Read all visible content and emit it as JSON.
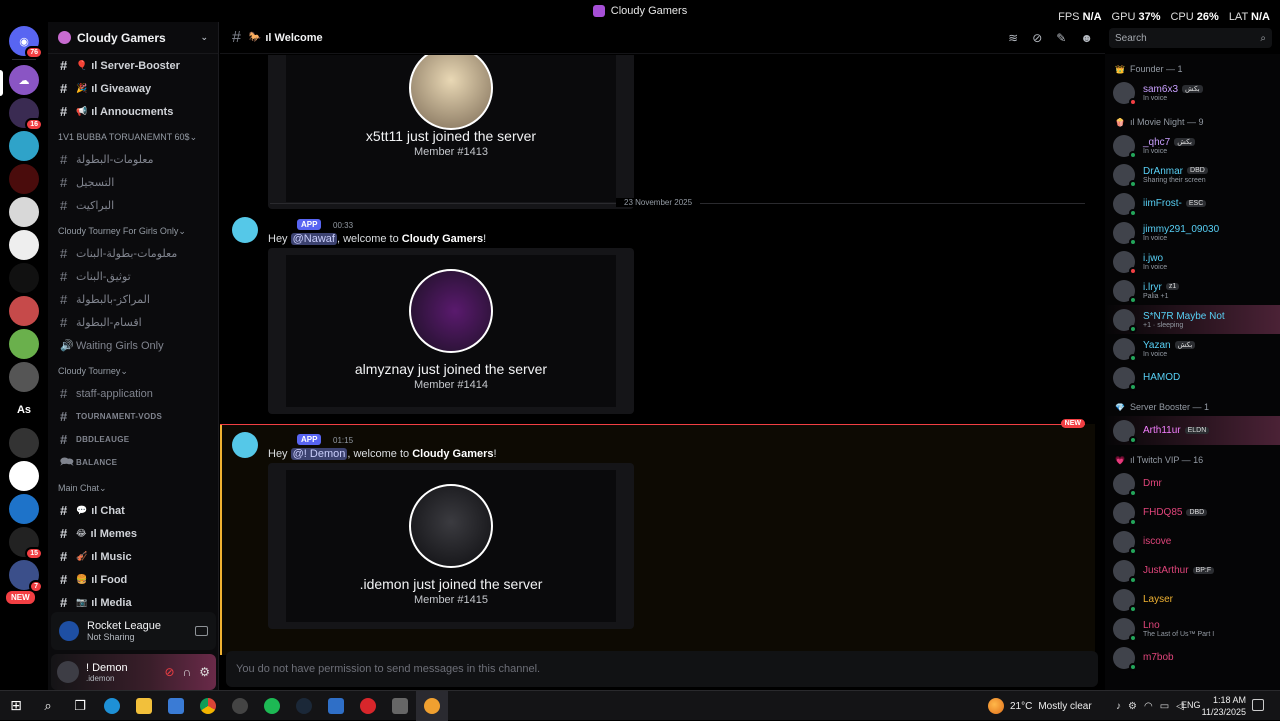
{
  "window": {
    "title": "Cloudy Gamers"
  },
  "overlay": {
    "fps_label": "FPS",
    "fps": "N/A",
    "gpu_label": "GPU",
    "gpu": "37%",
    "cpu_label": "CPU",
    "cpu": "26%",
    "lat_label": "LAT",
    "lat": "N/A"
  },
  "servers": {
    "badges": [
      "76",
      "16",
      "15",
      "7"
    ],
    "new_label": "NEW",
    "as_label": "As"
  },
  "sidebar": {
    "server_name": "Cloudy Gamers",
    "items": [
      {
        "type": "ch",
        "label": "ıl Server-Booster",
        "emo": "🎈",
        "bright": true
      },
      {
        "type": "ch",
        "label": "ıl Giveaway",
        "emo": "🎉",
        "bright": true
      },
      {
        "type": "ch",
        "label": "ıl Annoucments",
        "emo": "📢",
        "bright": true
      },
      {
        "type": "cat",
        "label": "1V1 BUBBA TORUANEMNT 60$"
      },
      {
        "type": "ch",
        "label": "معلومات-البطولة"
      },
      {
        "type": "ch",
        "label": "التسجيل"
      },
      {
        "type": "ch",
        "label": "البراكيت"
      },
      {
        "type": "cat",
        "label": "Cloudy Tourney For Girls Only"
      },
      {
        "type": "ch",
        "label": "معلومات-بطولة-البنات"
      },
      {
        "type": "ch",
        "label": "توثيق-البنات"
      },
      {
        "type": "ch",
        "label": "المراكز-بالبطولة"
      },
      {
        "type": "ch",
        "label": "اقسام-البطولة"
      },
      {
        "type": "voice",
        "label": "Waiting Girls Only"
      },
      {
        "type": "cat",
        "label": "Cloudy Tourney"
      },
      {
        "type": "ch",
        "label": "staff-application"
      },
      {
        "type": "ch",
        "label": "TOURNAMENT-VODS",
        "small": true
      },
      {
        "type": "ch",
        "label": "DBDLEAUGE",
        "small": true
      },
      {
        "type": "forum",
        "label": "BALANCE",
        "small": true
      },
      {
        "type": "cat",
        "label": "Main Chat"
      },
      {
        "type": "ch",
        "label": "ıl Chat",
        "emo": "💬",
        "bright": true
      },
      {
        "type": "ch",
        "label": "ıl Memes",
        "emo": "😂",
        "bright": true
      },
      {
        "type": "ch",
        "label": "ıl Music",
        "emo": "🎻",
        "bright": true
      },
      {
        "type": "ch",
        "label": "ıl Food",
        "emo": "🍔",
        "bright": true
      },
      {
        "type": "ch",
        "label": "ıl Media",
        "emo": "📷",
        "bright": true
      }
    ],
    "activity": {
      "game": "Rocket League",
      "status": "Not Sharing"
    },
    "user": {
      "name": "! Demon",
      "tag": ".idemon"
    }
  },
  "channel": {
    "name": "ıl Welcome",
    "emo": "🐎"
  },
  "messages": {
    "card0": {
      "joined": "x5tt11 just joined the server",
      "member": "Member #1413"
    },
    "date_divider": "23 November 2025",
    "msg1": {
      "app": "APP",
      "time": "00:33",
      "hey": "Hey ",
      "mention": "@Nawaf",
      "text": ", welcome to ",
      "server": "Cloudy Gamers",
      "end": "!",
      "joined": "almyznay just joined the server",
      "member": "Member #1414"
    },
    "new_label": "NEW",
    "msg2": {
      "app": "APP",
      "time": "01:15",
      "hey": "Hey ",
      "mention": "@! Demon",
      "text": ", welcome to ",
      "server": "Cloudy Gamers",
      "end": "!",
      "joined": ".idemon just joined the server",
      "member": "Member #1415"
    },
    "composer": "You do not have permission to send messages in this channel."
  },
  "search": {
    "placeholder": "Search"
  },
  "members": {
    "sections": [
      {
        "title": "Founder — 1",
        "emo": "👑",
        "list": [
          {
            "name": "sam6x3",
            "tag": "بكش",
            "sub": "In voice",
            "color": "#c9a0ff",
            "status": "dnd"
          }
        ]
      },
      {
        "title": "ıl Movie Night — 9",
        "emo": "🍿",
        "list": [
          {
            "name": "_qhc7",
            "tag": "بكش",
            "sub": "In voice",
            "color": "#c9a0ff",
            "status": "online"
          },
          {
            "name": "DrAnmar",
            "tag": "DBD",
            "sub": "Sharing their screen",
            "color": "#58d0f5",
            "status": "online"
          },
          {
            "name": "iimFrost-",
            "tag": "ESC",
            "sub": "",
            "color": "#58d0f5",
            "status": "online"
          },
          {
            "name": "jimmy291_09030",
            "tag": "",
            "sub": "In voice",
            "color": "#58d0f5",
            "status": "online"
          },
          {
            "name": "i.jwo",
            "tag": "",
            "sub": "In voice",
            "color": "#58d0f5",
            "status": "dnd"
          },
          {
            "name": "i.lryr",
            "tag": "z1",
            "sub": "Palia +1",
            "color": "#58d0f5",
            "status": "online"
          },
          {
            "name": "S*N7R Maybe Not",
            "tag": "",
            "sub": "+1 · sleeping",
            "color": "#58d0f5",
            "status": "online",
            "hl": true
          },
          {
            "name": "Yazan",
            "tag": "بكش",
            "sub": "In voice",
            "color": "#58d0f5",
            "status": "online"
          },
          {
            "name": "HAMOD",
            "tag": "",
            "sub": "",
            "color": "#58d0f5",
            "status": "online"
          }
        ]
      },
      {
        "title": "Server Booster — 1",
        "emo": "💎",
        "list": [
          {
            "name": "Arth11ur",
            "tag": "ELDN",
            "sub": "",
            "color": "#f47fff",
            "status": "online",
            "hl": true
          }
        ]
      },
      {
        "title": "ıl Twitch VIP — 16",
        "emo": "💗",
        "list": [
          {
            "name": "Dmr",
            "tag": "",
            "sub": "",
            "color": "#e0457b",
            "status": "online"
          },
          {
            "name": "FHDQ85",
            "tag": "DBD",
            "sub": "",
            "color": "#e0457b",
            "status": "online"
          },
          {
            "name": "iscove",
            "tag": "",
            "sub": "",
            "color": "#e0457b",
            "status": "online"
          },
          {
            "name": "JustArthur",
            "tag": "BP:F",
            "sub": "",
            "color": "#e0457b",
            "status": "online"
          },
          {
            "name": "Layser",
            "tag": "",
            "sub": "",
            "color": "#f0b232",
            "status": "online"
          },
          {
            "name": "Lno",
            "tag": "",
            "sub": "The Last of Us™ Part I",
            "color": "#e0457b",
            "status": "online"
          },
          {
            "name": "m7bob",
            "tag": "",
            "sub": "",
            "color": "#e0457b",
            "status": "online"
          }
        ]
      }
    ]
  },
  "taskbar": {
    "weather_temp": "21°C",
    "weather_text": "Mostly clear",
    "lang": "ENG",
    "time": "1:18 AM",
    "date": "11/23/2025"
  }
}
